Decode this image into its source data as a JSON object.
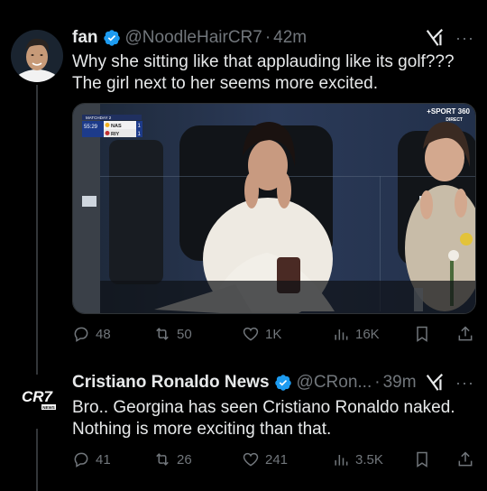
{
  "tweets": [
    {
      "name": "fan",
      "handle": "@NoodleHairCR7",
      "separator": "·",
      "time": "42m",
      "more": "···",
      "text_lines": [
        "Why she sitting like that applauding like its golf???",
        "The girl next to her seems more excited."
      ],
      "media": {
        "broadcaster": "+SPORT 360",
        "broadcaster_sub": "DIRECT",
        "scoreboard": {
          "label": "MATCHDAY 2",
          "clock": "55:29",
          "home_team": "NAS",
          "home_score": "1",
          "away_team": "RIY",
          "away_score": "1"
        }
      },
      "stats": {
        "replies": "48",
        "reposts": "50",
        "likes": "1K",
        "views": "16K"
      },
      "colors": {
        "verified": "#1d9bf0"
      }
    },
    {
      "name": "Cristiano Ronaldo News",
      "handle": "@CRon...",
      "separator": "·",
      "time": "39m",
      "more": "···",
      "avatar_text": "CR7",
      "avatar_sub": "NEWS",
      "text_lines": [
        "Bro.. Georgina has seen Cristiano Ronaldo naked.",
        "Nothing is more exciting than that."
      ],
      "stats": {
        "replies": "41",
        "reposts": "26",
        "likes": "241",
        "views": "3.5K"
      },
      "colors": {
        "verified": "#1d9bf0"
      }
    }
  ],
  "icons": [
    "reply-icon",
    "repost-icon",
    "like-icon",
    "views-icon",
    "bookmark-icon",
    "share-icon",
    "verified-icon",
    "grok-icon"
  ]
}
